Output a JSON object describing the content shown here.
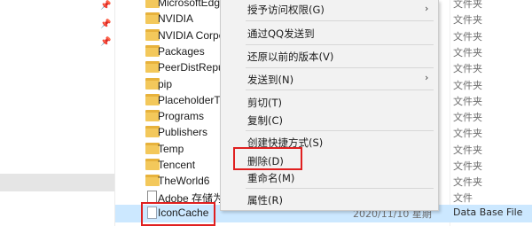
{
  "files": [
    {
      "name": "MicrosoftEdg",
      "type": "文件夹",
      "kind": "folder"
    },
    {
      "name": "NVIDIA",
      "type": "文件夹",
      "kind": "folder"
    },
    {
      "name": "NVIDIA Corpo",
      "type": "文件夹",
      "kind": "folder"
    },
    {
      "name": "Packages",
      "type": "文件夹",
      "kind": "folder"
    },
    {
      "name": "PeerDistRepul",
      "type": "文件夹",
      "kind": "folder"
    },
    {
      "name": "pip",
      "type": "文件夹",
      "kind": "folder"
    },
    {
      "name": "PlaceholderTil",
      "type": "文件夹",
      "kind": "folder"
    },
    {
      "name": "Programs",
      "type": "文件夹",
      "kind": "folder"
    },
    {
      "name": "Publishers",
      "type": "文件夹",
      "kind": "folder"
    },
    {
      "name": "Temp",
      "type": "文件夹",
      "kind": "folder"
    },
    {
      "name": "Tencent",
      "type": "文件夹",
      "kind": "folder"
    },
    {
      "name": "TheWorld6",
      "type": "文件夹",
      "kind": "folder"
    },
    {
      "name": "Adobe 存储为",
      "type": "文件",
      "kind": "doc"
    },
    {
      "name": "IconCache",
      "type": "Data Base File",
      "date": "2020/11/10 星期",
      "kind": "doc",
      "selected": true
    }
  ],
  "context_menu": {
    "items": [
      {
        "label": "授予访问权限(G)",
        "submenu": true
      },
      {
        "label": "通过QQ发送到"
      },
      {
        "label": "还原以前的版本(V)"
      },
      {
        "label": "发送到(N)",
        "submenu": true
      },
      {
        "label": "剪切(T)"
      },
      {
        "label": "复制(C)"
      },
      {
        "label": "创建快捷方式(S)"
      },
      {
        "label": "删除(D)",
        "highlighted": true
      },
      {
        "label": "重命名(M)"
      },
      {
        "label": "属性(R)"
      }
    ]
  },
  "colors": {
    "highlight_box": "#e02020",
    "selection": "#cce8ff",
    "folder": "#f3c85b"
  }
}
